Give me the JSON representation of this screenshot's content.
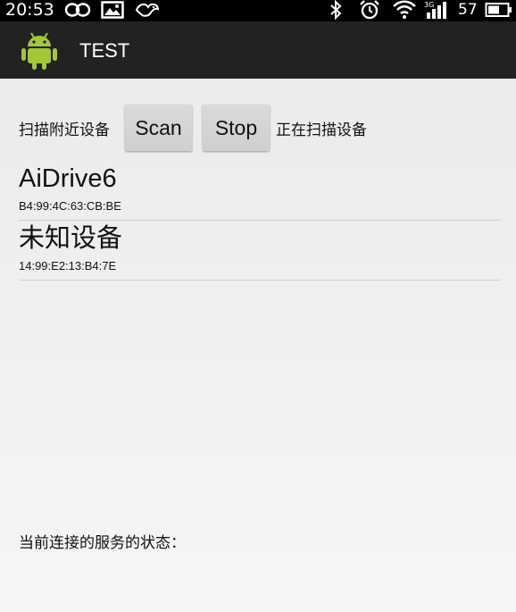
{
  "status_bar": {
    "time": "20:53",
    "battery_level": "57",
    "icons": [
      "infinity-icon",
      "image-icon",
      "notification-bird-icon",
      "bluetooth-icon",
      "alarm-clock-icon",
      "wifi-icon",
      "signal-3g-icon",
      "battery-icon"
    ]
  },
  "action_bar": {
    "title": "TEST",
    "app_icon": "android-icon"
  },
  "scan_controls": {
    "label": "扫描附近设备",
    "scan_button": "Scan",
    "stop_button": "Stop",
    "status": "正在扫描设备"
  },
  "devices": [
    {
      "name": "AiDrive6",
      "address": "B4:99:4C:63:CB:BE"
    },
    {
      "name": "未知设备",
      "address": "14:99:E2:13:B4:7E"
    }
  ],
  "service": {
    "label": "当前连接的服务的状态："
  }
}
